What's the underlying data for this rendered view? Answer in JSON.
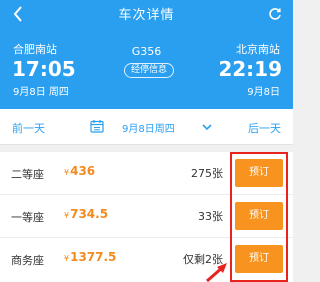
{
  "header": {
    "title": "车次详情",
    "train_no": "G356",
    "stops_label": "经停信息",
    "from": {
      "station": "合肥南站",
      "time": "17:05",
      "date": "9月8日 周四"
    },
    "to": {
      "station": "北京南站",
      "time": "22:19",
      "date": "9月8日"
    }
  },
  "datebar": {
    "prev": "前一天",
    "current": "9月8日周四",
    "next": "后一天"
  },
  "seats": [
    {
      "name": "二等座",
      "currency": "¥",
      "price": "436",
      "count": "275张",
      "action": "预订"
    },
    {
      "name": "一等座",
      "currency": "¥",
      "price": "734.5",
      "count": "33张",
      "action": "预订"
    },
    {
      "name": "商务座",
      "currency": "¥",
      "price": "1377.5",
      "count": "仅剩2张",
      "action": "预订"
    }
  ],
  "colors": {
    "header_blue": "#2a9ff0",
    "price_orange": "#f58a1f",
    "button_orange": "#f7931e",
    "highlight_red": "#e8231f"
  },
  "icons": [
    "back-icon",
    "refresh-icon",
    "calendar-icon",
    "chevron-down-icon",
    "arrow-annotation-icon"
  ]
}
